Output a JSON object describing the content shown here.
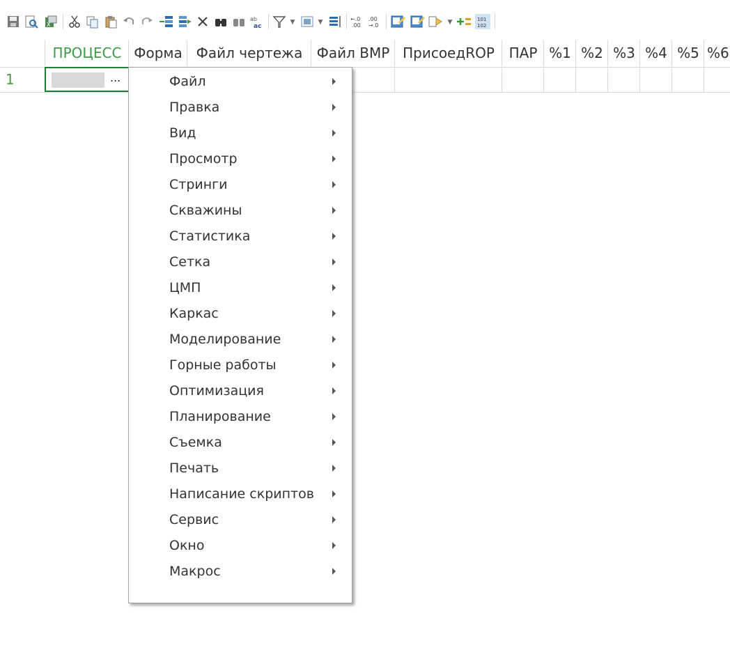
{
  "toolbar": {
    "icons": [
      "save-icon",
      "print-preview-icon",
      "export-excel-icon",
      "cut-icon",
      "copy-icon",
      "paste-icon",
      "undo-icon",
      "redo-icon",
      "insert-row-icon",
      "append-row-icon",
      "delete-icon",
      "find-icon",
      "find-replace-icon",
      "replace-abc-icon",
      "filter-icon",
      "columns-icon",
      "sort-icon",
      "increase-decimal-icon",
      "decrease-decimal-icon",
      "edit-sheet-icon",
      "edit-script-icon",
      "run-macro-icon",
      "add-field-icon",
      "binary-icon"
    ]
  },
  "grid": {
    "columns": [
      "ПРОЦЕСС",
      "Форма",
      "Файл чертежа",
      "Файл BMP",
      "ПрисоедROP",
      "ПАР",
      "%1",
      "%2",
      "%3",
      "%4",
      "%5",
      "%6"
    ],
    "active_column": "ПРОЦЕСС",
    "rows": [
      {
        "number": "1",
        "cell_button": "..."
      }
    ]
  },
  "context_menu": {
    "items": [
      "Файл",
      "Правка",
      "Вид",
      "Просмотр",
      "Стринги",
      "Скважины",
      "Статистика",
      "Сетка",
      "ЦМП",
      "Каркас",
      "Моделирование",
      "Горные работы",
      "Оптимизация",
      "Планирование",
      "Съемка",
      "Печать",
      "Написание скриптов",
      "Сервис",
      "Окно",
      "Макрос"
    ]
  },
  "colors": {
    "active_header_text": "#3f9a47",
    "row_number_text": "#4f9c46",
    "active_cell_border": "#1f7d39"
  }
}
